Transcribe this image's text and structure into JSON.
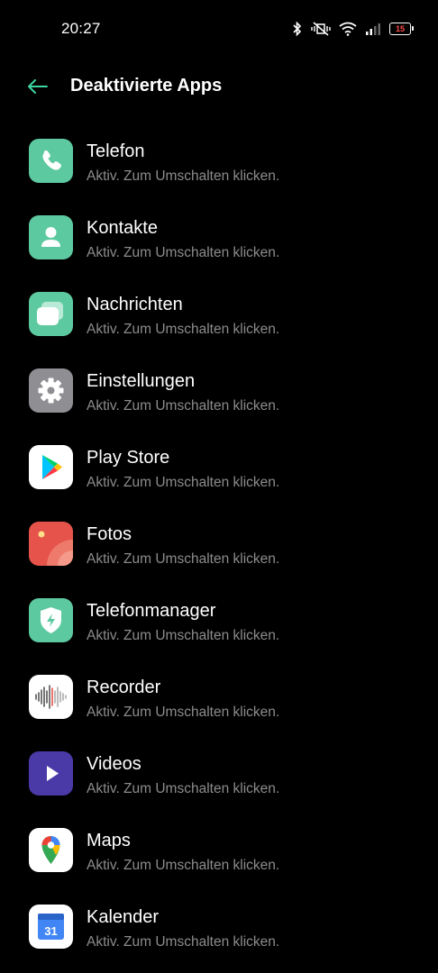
{
  "status": {
    "time": "20:27",
    "battery": "15"
  },
  "header": {
    "title": "Deaktivierte Apps"
  },
  "apps": [
    {
      "name": "Telefon",
      "status": "Aktiv. Zum Umschalten klicken."
    },
    {
      "name": "Kontakte",
      "status": "Aktiv. Zum Umschalten klicken."
    },
    {
      "name": "Nachrichten",
      "status": "Aktiv. Zum Umschalten klicken."
    },
    {
      "name": "Einstellungen",
      "status": "Aktiv. Zum Umschalten klicken."
    },
    {
      "name": "Play Store",
      "status": "Aktiv. Zum Umschalten klicken."
    },
    {
      "name": "Fotos",
      "status": "Aktiv. Zum Umschalten klicken."
    },
    {
      "name": "Telefonmanager",
      "status": "Aktiv. Zum Umschalten klicken."
    },
    {
      "name": "Recorder",
      "status": "Aktiv. Zum Umschalten klicken."
    },
    {
      "name": "Videos",
      "status": "Aktiv. Zum Umschalten klicken."
    },
    {
      "name": "Maps",
      "status": "Aktiv. Zum Umschalten klicken."
    },
    {
      "name": "Kalender",
      "status": "Aktiv. Zum Umschalten klicken."
    }
  ],
  "calendar_day": "31",
  "colors": {
    "accent": "#3dd6a0",
    "green_icon": "#5dc9a1",
    "gray_icon": "#8e8e93",
    "subtitle": "#8c8c8c"
  }
}
